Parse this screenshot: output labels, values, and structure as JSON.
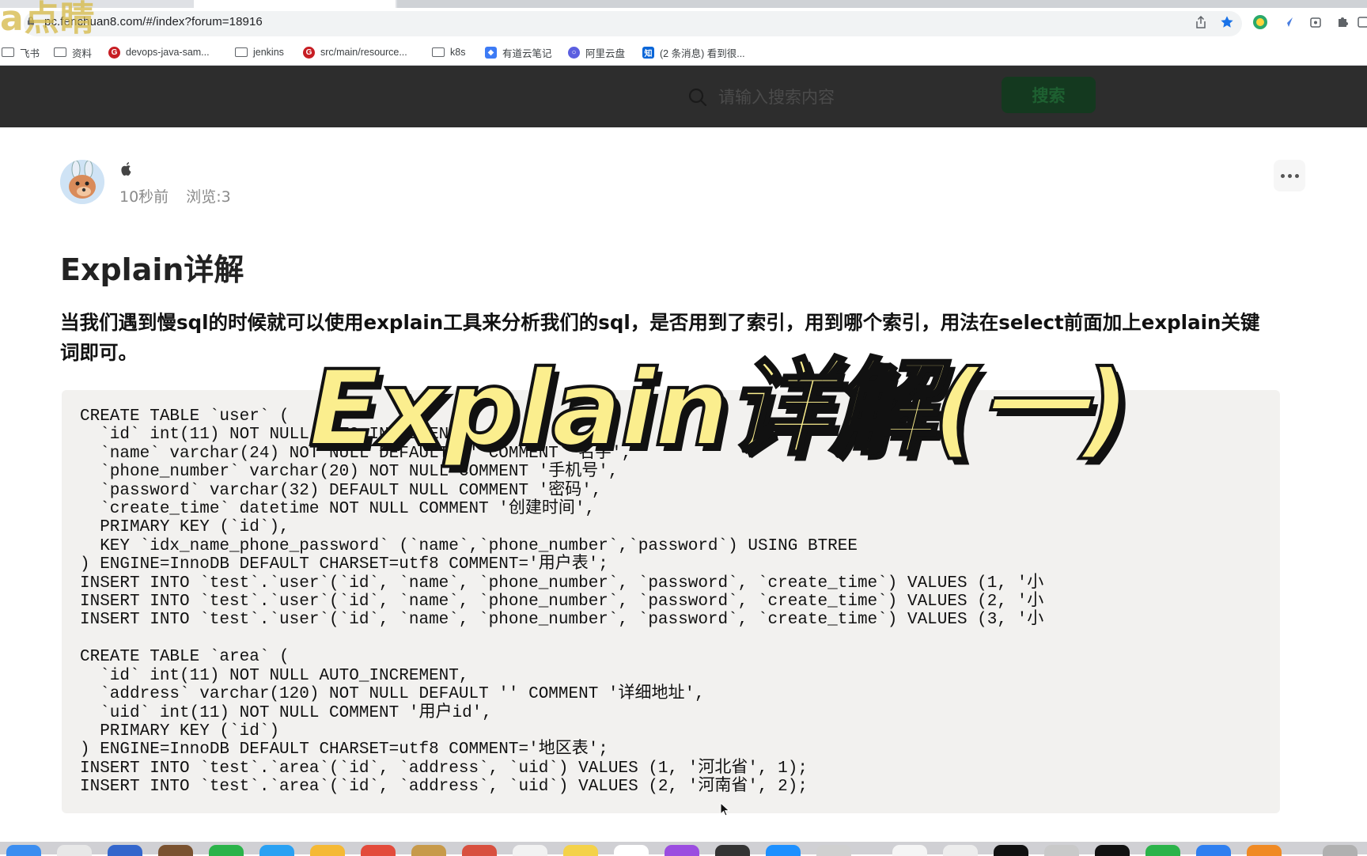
{
  "browser": {
    "url": "pc.fenchuan8.com/#/index?forum=18916",
    "bookmarks": [
      {
        "label": "飞书",
        "kind": "folder"
      },
      {
        "label": "资料",
        "kind": "folder"
      },
      {
        "label": "devops-java-sam...",
        "kind": "gitee"
      },
      {
        "label": "jenkins",
        "kind": "folder"
      },
      {
        "label": "src/main/resource...",
        "kind": "gitee"
      },
      {
        "label": "k8s",
        "kind": "folder"
      },
      {
        "label": "有道云笔记",
        "kind": "youdao"
      },
      {
        "label": "阿里云盘",
        "kind": "aliyun"
      },
      {
        "label": "(2 条消息) 看到很...",
        "kind": "zhihu"
      }
    ]
  },
  "watermark": "a点睛",
  "header": {
    "search_placeholder": "请输入搜索内容",
    "search_button": "搜索"
  },
  "post": {
    "time": "10秒前",
    "views": "浏览:3",
    "title": "Explain详解",
    "intro": "当我们遇到慢sql的时候就可以使用explain工具来分析我们的sql，是否用到了索引，用到哪个索引，用法在select前面加上explain关键词即可。",
    "code_lines": [
      "CREATE TABLE `user` (",
      "  `id` int(11) NOT NULL AUTO_INCREMENT,",
      "  `name` varchar(24) NOT NULL DEFAULT '' COMMENT '名字',",
      "  `phone_number` varchar(20) NOT NULL COMMENT '手机号',",
      "  `password` varchar(32) DEFAULT NULL COMMENT '密码',",
      "  `create_time` datetime NOT NULL COMMENT '创建时间',",
      "  PRIMARY KEY (`id`),",
      "  KEY `idx_name_phone_password` (`name`,`phone_number`,`password`) USING BTREE",
      ") ENGINE=InnoDB DEFAULT CHARSET=utf8 COMMENT='用户表';",
      "INSERT INTO `test`.`user`(`id`, `name`, `phone_number`, `password`, `create_time`) VALUES (1, '小",
      "INSERT INTO `test`.`user`(`id`, `name`, `phone_number`, `password`, `create_time`) VALUES (2, '小",
      "INSERT INTO `test`.`user`(`id`, `name`, `phone_number`, `password`, `create_time`) VALUES (3, '小",
      "",
      "CREATE TABLE `area` (",
      "  `id` int(11) NOT NULL AUTO_INCREMENT,",
      "  `address` varchar(120) NOT NULL DEFAULT '' COMMENT '详细地址',",
      "  `uid` int(11) NOT NULL COMMENT '用户id',",
      "  PRIMARY KEY (`id`)",
      ") ENGINE=InnoDB DEFAULT CHARSET=utf8 COMMENT='地区表';",
      "INSERT INTO `test`.`area`(`id`, `address`, `uid`) VALUES (1, '河北省', 1);",
      "INSERT INTO `test`.`area`(`id`, `address`, `uid`) VALUES (2, '河南省', 2);"
    ]
  },
  "overlay_title": "Explain详解(一)"
}
